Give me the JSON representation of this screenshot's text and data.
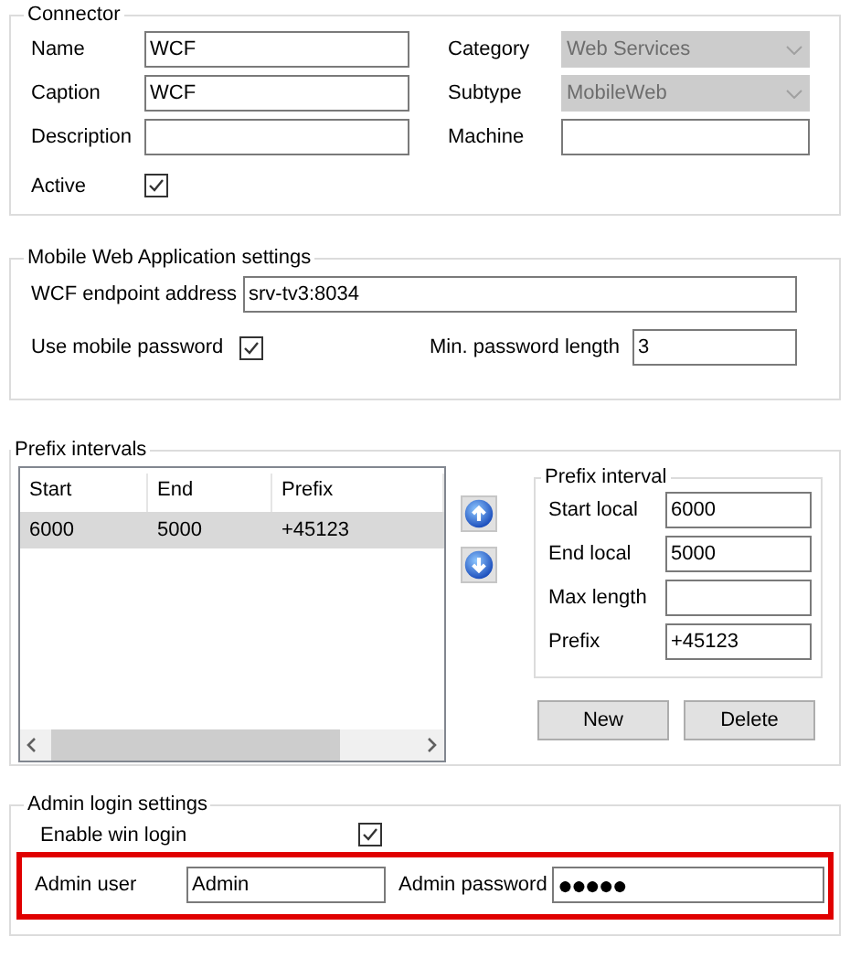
{
  "connector": {
    "title": "Connector",
    "fields": [
      {
        "label": "Name",
        "value": "WCF",
        "kind": "text",
        "disabled": false
      },
      {
        "label": "Category",
        "value": "Web Services",
        "kind": "combo",
        "disabled": true
      },
      {
        "label": "Caption",
        "value": "WCF",
        "kind": "text",
        "disabled": false
      },
      {
        "label": "Subtype",
        "value": "MobileWeb",
        "kind": "combo",
        "disabled": true
      },
      {
        "label": "Description",
        "kind": "text",
        "disabled": false
      },
      {
        "label": "Machine",
        "kind": "text",
        "disabled": false
      }
    ],
    "active": {
      "label": "Active",
      "checked": true
    }
  },
  "mobile": {
    "title": "Mobile Web Application settings",
    "endpoint": {
      "label": "WCF endpoint address",
      "value": "srv-tv3:8034"
    },
    "use_mobile_password": {
      "label": "Use mobile password",
      "checked": true
    },
    "min_password_length": {
      "label": "Min. password length",
      "value": "3"
    }
  },
  "prefix_intervals": {
    "title": "Prefix intervals",
    "table": {
      "columns": [
        "Start",
        "End",
        "Prefix"
      ],
      "rows": [
        {
          "cells": [
            "6000",
            "5000",
            "+45123"
          ],
          "selected": true
        }
      ]
    },
    "detail": {
      "title": "Prefix interval",
      "fields": [
        {
          "label": "Start local",
          "value": "6000"
        },
        {
          "label": "End local",
          "value": "5000"
        },
        {
          "label": "Max length"
        },
        {
          "label": "Prefix",
          "value": "+45123"
        }
      ]
    },
    "buttons": [
      "New",
      "Delete"
    ]
  },
  "admin": {
    "title": "Admin login settings",
    "enable_win_login": {
      "label": "Enable win login",
      "checked": true
    },
    "highlighted": true,
    "admin_user": {
      "label": "Admin user",
      "value": "Admin"
    },
    "admin_password": {
      "label": "Admin password",
      "value": "●●●●●"
    }
  }
}
